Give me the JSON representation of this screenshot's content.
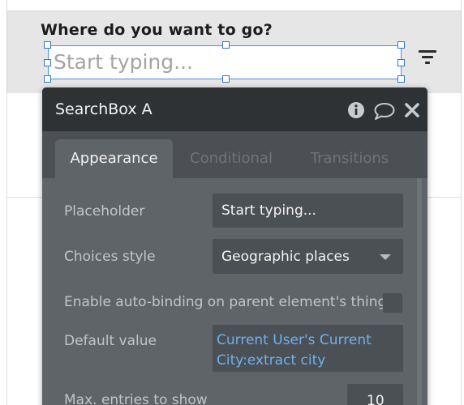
{
  "canvas": {
    "question": "Where do you want to go?",
    "search_placeholder": "Start typing..."
  },
  "panel": {
    "title": "SearchBox A",
    "header_icons": [
      "info-icon",
      "comment-icon",
      "close-icon"
    ],
    "tabs": [
      {
        "label": "Appearance",
        "active": true
      },
      {
        "label": "Conditional",
        "active": false
      },
      {
        "label": "Transitions",
        "active": false
      }
    ],
    "properties": {
      "placeholder": {
        "label": "Placeholder",
        "value": "Start typing..."
      },
      "choices_style": {
        "label": "Choices style",
        "value": "Geographic places"
      },
      "auto_binding": {
        "label": "Enable auto-binding on parent element's thing",
        "checked": false
      },
      "default_value": {
        "label": "Default value",
        "value": "Current User's Current City:extract city"
      },
      "max_entries": {
        "label": "Max. entries to show",
        "value": "10"
      }
    }
  },
  "colors": {
    "panel_bg": "#5f6468",
    "panel_header": "#2e3235",
    "selection_blue": "#2f74d6",
    "dynamic_text": "#6fb0ef"
  }
}
